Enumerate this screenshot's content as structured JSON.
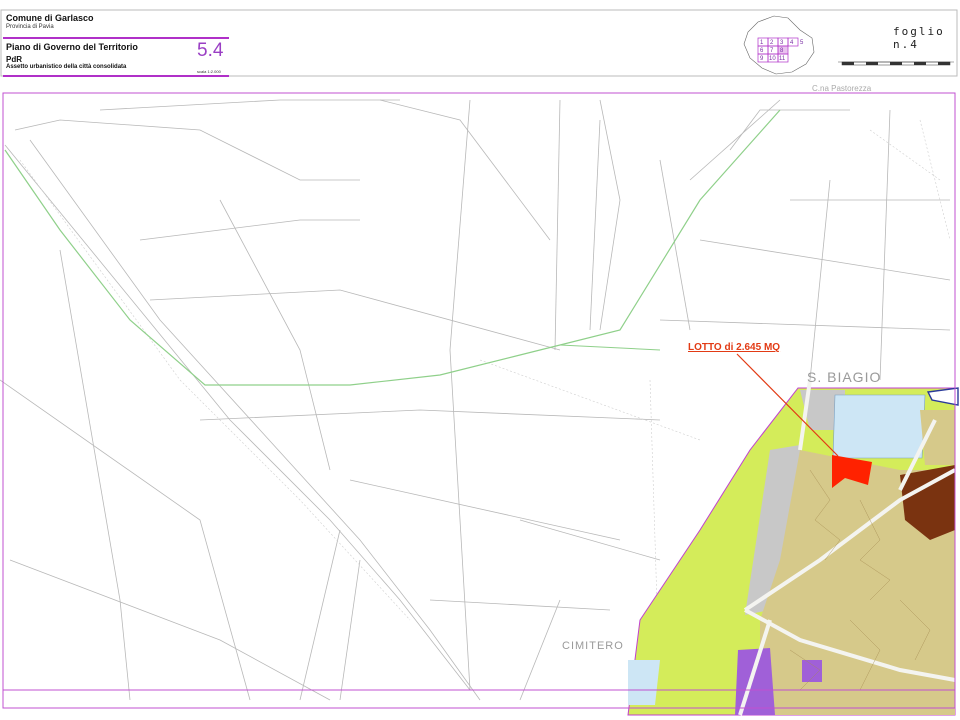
{
  "header": {
    "comune": "Comune di Garlasco",
    "provincia": "Provincia di Pavia",
    "plan_title": "Piano di Governo del Territorio",
    "plan_section": "PdR",
    "plan_subtitle": "Assetto urbanistico della città consolidata",
    "doc_code": "5.4",
    "scale_text": "scala 1:2.000",
    "sheet_label": "foglio n.4"
  },
  "key_map": {
    "cells": [
      "1",
      "2",
      "3",
      "4",
      "5",
      "6",
      "7",
      "8",
      "9",
      "10",
      "11"
    ]
  },
  "map": {
    "lot_label": "LOTTO di 2.645 MQ",
    "locality_label": "S. BIAGIO",
    "cemetery_label": "CIMITERO",
    "road_label": "C.na Pastorezza"
  },
  "colors": {
    "frame": "#c050d0",
    "accent": "#9a3fc4",
    "lot": "#ff2200",
    "zone_yellow": "#d4ec5a",
    "zone_tan": "#d6c98a",
    "zone_brown": "#7a3310",
    "zone_purple": "#a060d8",
    "zone_lightblue": "#cde6f5",
    "zone_grey": "#c8c8c8",
    "green_path": "#8fd08a"
  }
}
